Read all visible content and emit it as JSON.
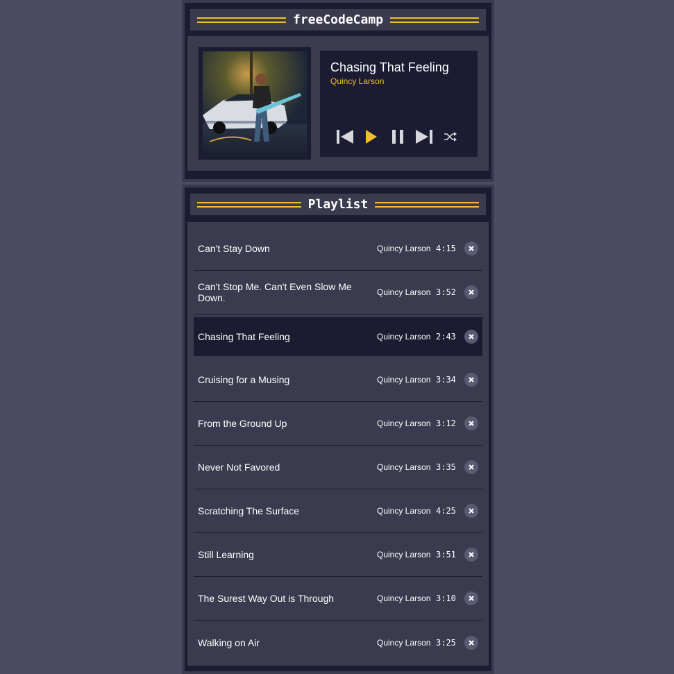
{
  "player": {
    "brand": "freeCodeCamp",
    "current_song": {
      "title": "Chasing That Feeling",
      "artist": "Quincy Larson"
    },
    "controls": [
      "previous-icon",
      "play-icon",
      "pause-icon",
      "next-icon",
      "shuffle-icon"
    ]
  },
  "playlist": {
    "heading": "Playlist",
    "songs": [
      {
        "title": "Can't Stay Down",
        "artist": "Quincy Larson",
        "duration": "4:15"
      },
      {
        "title": "Can't Stop Me. Can't Even Slow Me Down.",
        "artist": "Quincy Larson",
        "duration": "3:52"
      },
      {
        "title": "Chasing That Feeling",
        "artist": "Quincy Larson",
        "duration": "2:43"
      },
      {
        "title": "Cruising for a Musing",
        "artist": "Quincy Larson",
        "duration": "3:34"
      },
      {
        "title": "From the Ground Up",
        "artist": "Quincy Larson",
        "duration": "3:12"
      },
      {
        "title": "Never Not Favored",
        "artist": "Quincy Larson",
        "duration": "3:35"
      },
      {
        "title": "Scratching The Surface",
        "artist": "Quincy Larson",
        "duration": "4:25"
      },
      {
        "title": "Still Learning",
        "artist": "Quincy Larson",
        "duration": "3:51"
      },
      {
        "title": "The Surest Way Out is Through",
        "artist": "Quincy Larson",
        "duration": "3:10"
      },
      {
        "title": "Walking on Air",
        "artist": "Quincy Larson",
        "duration": "3:25"
      }
    ]
  },
  "colors": {
    "accent": "#f1be32",
    "panel": "#1b1b32",
    "surface": "#3b3b4f",
    "page": "#4b4c62"
  }
}
